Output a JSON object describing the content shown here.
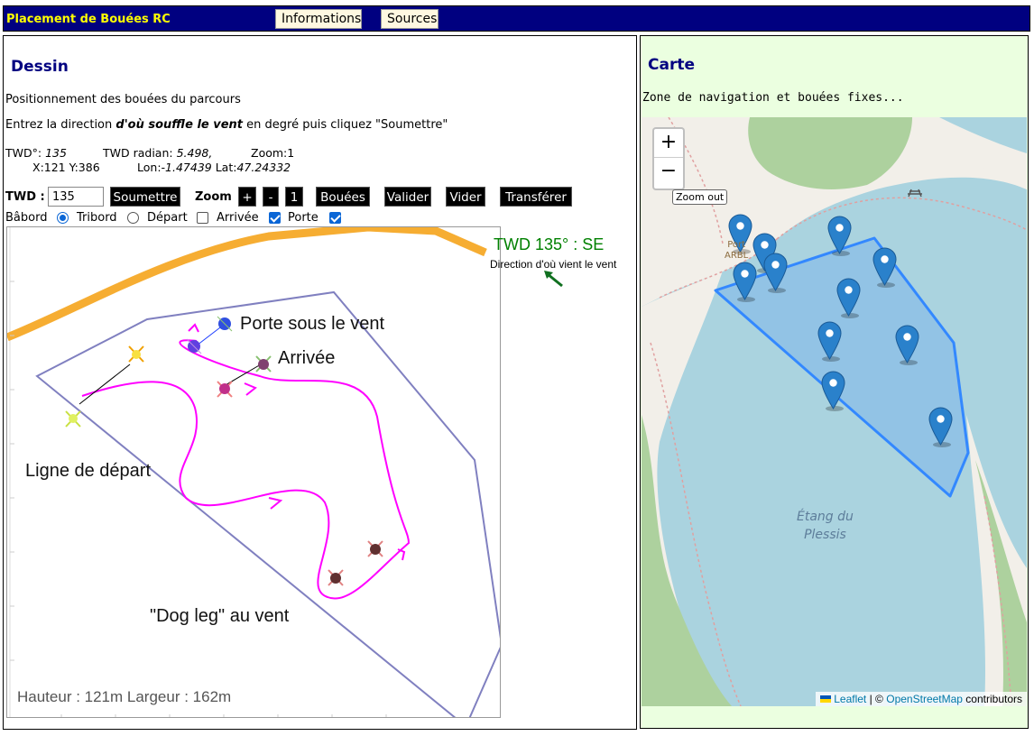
{
  "app": {
    "title": "Placement de Bouées RC"
  },
  "nav": {
    "info_label": "Informations",
    "sources_label": "Sources"
  },
  "dessin": {
    "title": "Dessin",
    "description": "Positionnement des bouées du parcours",
    "instruction_prefix": "Entrez la direction ",
    "instruction_emphasis": "d'où souffle le vent",
    "instruction_suffix": " en degré puis cliquez \"Soumettre\"",
    "twd_deg_label": "TWD°:",
    "twd_deg_value": "135",
    "twd_rad_label": "TWD radian:",
    "twd_rad_value": "5.498,",
    "zoom_info": "Zoom:1",
    "xy_info": "X:121 Y:386",
    "lon_label": "Lon:",
    "lon_value": "-1.47439",
    "lat_label": "Lat:",
    "lat_value": "47.24332"
  },
  "toolbar": {
    "twd_label": "TWD :",
    "twd_value": "135",
    "submit_label": "Soumettre",
    "zoom_label": "Zoom",
    "zoom_in_label": "+",
    "zoom_out_label": "-",
    "zoom_reset_label": "1",
    "buoys_label": "Bouées",
    "validate_label": "Valider",
    "clear_label": "Vider",
    "transfer_label": "Transférer"
  },
  "options": {
    "port_label": "Bâbord",
    "port_checked": true,
    "starboard_label": "Tribord",
    "starboard_checked": false,
    "start_label": "Départ",
    "start_checked": false,
    "finish_label": "Arrivée",
    "finish_checked": true,
    "gate_label": "Porte",
    "gate_checked": true
  },
  "drawing": {
    "label_gate": "Porte sous le vent",
    "label_finish": "Arrivée",
    "label_start": "Ligne de départ",
    "label_dogleg": "\"Dog leg\" au vent",
    "dimensions": "Hauteur : 121m  Largeur : 162m",
    "wind_title": "TWD 135° : SE",
    "wind_subtitle": "Direction d'où vient le vent"
  },
  "carte": {
    "title": "Carte",
    "description": "Zone de navigation et bouées fixes...",
    "zoom_in_label": "+",
    "zoom_out_label": "−",
    "zoom_tooltip": "Zoom out",
    "lake_name_1": "Étang du",
    "lake_name_2": "Plessis",
    "place_name_1": "Port",
    "place_name_2": "ARBL",
    "attribution_leaflet": "Leaflet",
    "attribution_sep": "| © ",
    "attribution_osm": "OpenStreetMap",
    "attribution_suffix": " contributors",
    "marker_count": 11
  },
  "colors": {
    "topbar": "#000080",
    "title_yellow": "#ffff00",
    "heading_blue": "#000080",
    "map_panel_bg": "#ebffe0",
    "water": "#aad3df",
    "zone_stroke": "#3388ff",
    "course_path": "#ff00ff",
    "wind_green": "#008000"
  }
}
